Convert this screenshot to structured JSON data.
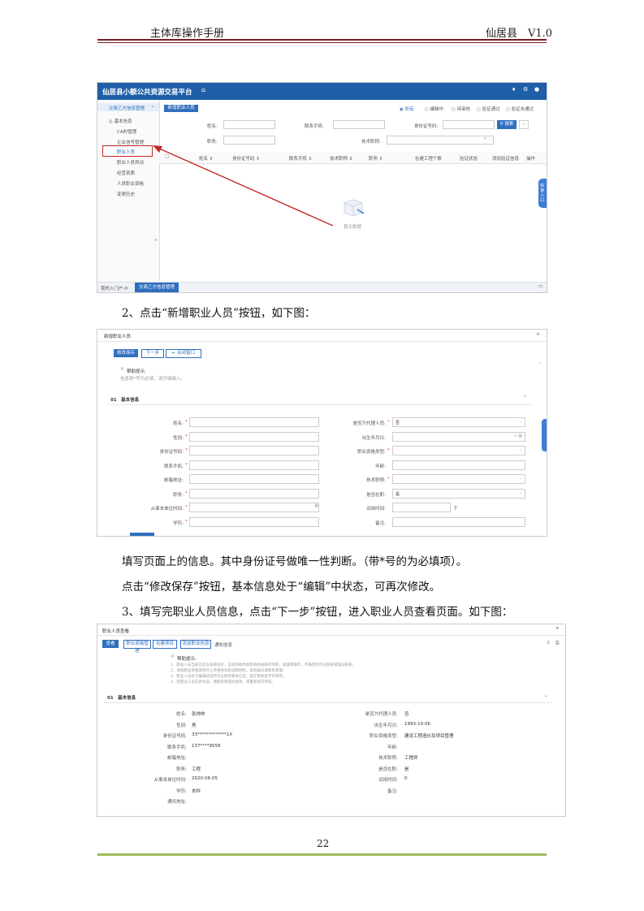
{
  "header": {
    "left": "主体库操作手册",
    "right": "仙居县　V1.0"
  },
  "page_number": "22",
  "para": {
    "p1": "2、点击“新增职业人员”按钮，如下图：",
    "p2": "填写页面上的信息。其中身份证号做唯一性判断。（带*号的为必填项）。",
    "p3": "点击“修改保存”按钮，基本信息处于“编辑”中状态，可再次修改。",
    "p4": "3、填写完职业人员信息，点击“下一步”按钮，进入职业人员查看页面。如下图："
  },
  "ss1": {
    "title": "仙居县小额公共资源交易平台",
    "sidebar_head": "交易乙方信息管理",
    "sidebar_group": "基本信息",
    "sidebar_items": [
      "CA的管理",
      "企业信号管理",
      "职业人员",
      "职业人员异动",
      "经营资质",
      "人员职业资格",
      "变更历史"
    ],
    "add_button": "新增职业人员",
    "radios": [
      "所有",
      "编辑中",
      "待审核",
      "验证通过",
      "验证未通过"
    ],
    "filter_labels": [
      "姓名:",
      "联系手机:",
      "身份证号码:",
      "职务:",
      "技术职称:"
    ],
    "search_button": "搜索",
    "columns": [
      "姓名",
      "身份证号码",
      "联系手机",
      "技术职称",
      "职务",
      "在建工程个数",
      "验证状态",
      "添加验证信息",
      "操作"
    ],
    "empty_text": "暂无数据",
    "side_tab": "快速入口",
    "bottom_tabs": [
      "我的入门户",
      "交易乙方信息管理"
    ]
  },
  "ss2": {
    "title": "新增职业人员",
    "buttons": [
      "修改保存",
      "下一步",
      "关闭窗口"
    ],
    "tip_title": "帮助提示:",
    "tip_text": "信息带*号为必填，请仔细填入。",
    "section": "01　基本信息",
    "left_labels": [
      "姓名:",
      "性别:",
      "身份证号码:",
      "联系手机:",
      "邮箱地址:",
      "职务:",
      "从事本单位时间:",
      "学历:"
    ],
    "right_labels": [
      "是否为代理人员:",
      "出生年月日:",
      "职业资格类型:",
      "年龄:",
      "技术职称:",
      "是否在职:",
      "试用时间:",
      "备注:"
    ],
    "right_values": [
      "否",
      "",
      "",
      "",
      "",
      "是",
      "",
      ""
    ],
    "trial_unit": "下"
  },
  "ss3": {
    "title": "职业人员查看",
    "tabs": [
      "查看",
      "职业资格管理",
      "在建项目",
      "添加职业信息",
      "通知信息"
    ],
    "tip_title": "帮助提示:",
    "tip_lines": [
      "1、职业人员当前信息与系统同步，信息的修改会影响相关联的项目，请谨慎操作，不确定时可与系统管理员联系。",
      "2、添加职业资格请及时上传相关资质证明材料，如有疑问请联系客服。",
      "3、职业人员处于编辑状态时可以修改基本信息，提交审核后不可修改。",
      "4、若职业人员信息有误，请联系管理员修改，或重新提交审核。"
    ],
    "section": "01　基本信息",
    "left_labels": [
      "姓名:",
      "性别:",
      "身份证号码:",
      "联系手机:",
      "邮箱地址:",
      "职务:",
      "从事本单位时间:",
      "学历:",
      "通讯地址:"
    ],
    "left_values": [
      "张帅帅",
      "男",
      "33*************1X",
      "137****9558",
      "",
      "工程",
      "2020-06-05",
      "本科",
      ""
    ],
    "right_labels": [
      "是否为代理人员:",
      "出生年月日:",
      "职业资格类型:",
      "年龄:",
      "技术职称:",
      "是否在职:",
      "试用时间:",
      "备注:"
    ],
    "right_values": [
      "否",
      "1993-10-06",
      "建设工程造价及项目管理",
      "",
      "工程师",
      "是",
      "0",
      ""
    ]
  }
}
